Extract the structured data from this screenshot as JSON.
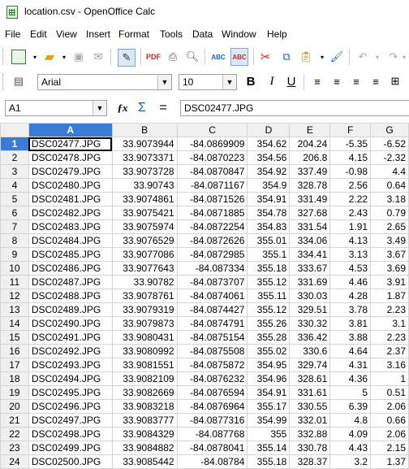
{
  "window": {
    "title": "location.csv - OpenOffice Calc"
  },
  "menu": [
    "File",
    "Edit",
    "View",
    "Insert",
    "Format",
    "Tools",
    "Data",
    "Window",
    "Help"
  ],
  "formatting": {
    "font_name": "Arial",
    "font_size": "10"
  },
  "formula_bar": {
    "cell_ref": "A1",
    "content": "DSC02477.JPG"
  },
  "sheet": {
    "columns": [
      "A",
      "B",
      "C",
      "D",
      "E",
      "F",
      "G"
    ],
    "selected_column": "A",
    "selected_row": 1,
    "rows": [
      {
        "n": "1",
        "a": "DSC02477.JPG",
        "b": "33.9073944",
        "c": "-84.0869909",
        "d": "354.62",
        "e": "204.24",
        "f": "-5.35",
        "g": "-6.52"
      },
      {
        "n": "2",
        "a": "DSC02478.JPG",
        "b": "33.9073371",
        "c": "-84.0870223",
        "d": "354.56",
        "e": "206.8",
        "f": "4.15",
        "g": "-2.32"
      },
      {
        "n": "3",
        "a": "DSC02479.JPG",
        "b": "33.9073728",
        "c": "-84.0870847",
        "d": "354.92",
        "e": "337.49",
        "f": "-0.98",
        "g": "4.4"
      },
      {
        "n": "4",
        "a": "DSC02480.JPG",
        "b": "33.90743",
        "c": "-84.0871167",
        "d": "354.9",
        "e": "328.78",
        "f": "2.56",
        "g": "0.64"
      },
      {
        "n": "5",
        "a": "DSC02481.JPG",
        "b": "33.9074861",
        "c": "-84.0871526",
        "d": "354.91",
        "e": "331.49",
        "f": "2.22",
        "g": "3.18"
      },
      {
        "n": "6",
        "a": "DSC02482.JPG",
        "b": "33.9075421",
        "c": "-84.0871885",
        "d": "354.78",
        "e": "327.68",
        "f": "2.43",
        "g": "0.79"
      },
      {
        "n": "7",
        "a": "DSC02483.JPG",
        "b": "33.9075974",
        "c": "-84.0872254",
        "d": "354.83",
        "e": "331.54",
        "f": "1.91",
        "g": "2.65"
      },
      {
        "n": "8",
        "a": "DSC02484.JPG",
        "b": "33.9076529",
        "c": "-84.0872626",
        "d": "355.01",
        "e": "334.06",
        "f": "4.13",
        "g": "3.49"
      },
      {
        "n": "9",
        "a": "DSC02485.JPG",
        "b": "33.9077086",
        "c": "-84.0872985",
        "d": "355.1",
        "e": "334.41",
        "f": "3.13",
        "g": "3.67"
      },
      {
        "n": "10",
        "a": "DSC02486.JPG",
        "b": "33.9077643",
        "c": "-84.087334",
        "d": "355.18",
        "e": "333.67",
        "f": "4.53",
        "g": "3.69"
      },
      {
        "n": "11",
        "a": "DSC02487.JPG",
        "b": "33.90782",
        "c": "-84.0873707",
        "d": "355.12",
        "e": "331.69",
        "f": "4.46",
        "g": "3.91"
      },
      {
        "n": "12",
        "a": "DSC02488.JPG",
        "b": "33.9078761",
        "c": "-84.0874061",
        "d": "355.11",
        "e": "330.03",
        "f": "4.28",
        "g": "1.87"
      },
      {
        "n": "13",
        "a": "DSC02489.JPG",
        "b": "33.9079319",
        "c": "-84.0874427",
        "d": "355.12",
        "e": "329.51",
        "f": "3.78",
        "g": "2.23"
      },
      {
        "n": "14",
        "a": "DSC02490.JPG",
        "b": "33.9079873",
        "c": "-84.0874791",
        "d": "355.26",
        "e": "330.32",
        "f": "3.81",
        "g": "3.1"
      },
      {
        "n": "15",
        "a": "DSC02491.JPG",
        "b": "33.9080431",
        "c": "-84.0875154",
        "d": "355.28",
        "e": "336.42",
        "f": "3.88",
        "g": "2.23"
      },
      {
        "n": "16",
        "a": "DSC02492.JPG",
        "b": "33.9080992",
        "c": "-84.0875508",
        "d": "355.02",
        "e": "330.6",
        "f": "4.64",
        "g": "2.37"
      },
      {
        "n": "17",
        "a": "DSC02493.JPG",
        "b": "33.9081551",
        "c": "-84.0875872",
        "d": "354.95",
        "e": "329.74",
        "f": "4.31",
        "g": "3.16"
      },
      {
        "n": "18",
        "a": "DSC02494.JPG",
        "b": "33.9082109",
        "c": "-84.0876232",
        "d": "354.96",
        "e": "328.61",
        "f": "4.36",
        "g": "1"
      },
      {
        "n": "19",
        "a": "DSC02495.JPG",
        "b": "33.9082669",
        "c": "-84.0876594",
        "d": "354.91",
        "e": "331.61",
        "f": "5",
        "g": "0.51"
      },
      {
        "n": "20",
        "a": "DSC02496.JPG",
        "b": "33.9083218",
        "c": "-84.0876964",
        "d": "355.17",
        "e": "330.55",
        "f": "6.39",
        "g": "2.06"
      },
      {
        "n": "21",
        "a": "DSC02497.JPG",
        "b": "33.9083777",
        "c": "-84.0877316",
        "d": "354.99",
        "e": "332.01",
        "f": "4.8",
        "g": "0.66"
      },
      {
        "n": "22",
        "a": "DSC02498.JPG",
        "b": "33.9084329",
        "c": "-84.087768",
        "d": "355",
        "e": "332.88",
        "f": "4.09",
        "g": "2.06"
      },
      {
        "n": "23",
        "a": "DSC02499.JPG",
        "b": "33.9084882",
        "c": "-84.0878041",
        "d": "355.14",
        "e": "330.78",
        "f": "4.43",
        "g": "2.15"
      },
      {
        "n": "24",
        "a": "DSC02500.JPG",
        "b": "33.9085442",
        "c": "-84.08784",
        "d": "355.18",
        "e": "328.37",
        "f": "3.2",
        "g": "1.37"
      }
    ]
  }
}
